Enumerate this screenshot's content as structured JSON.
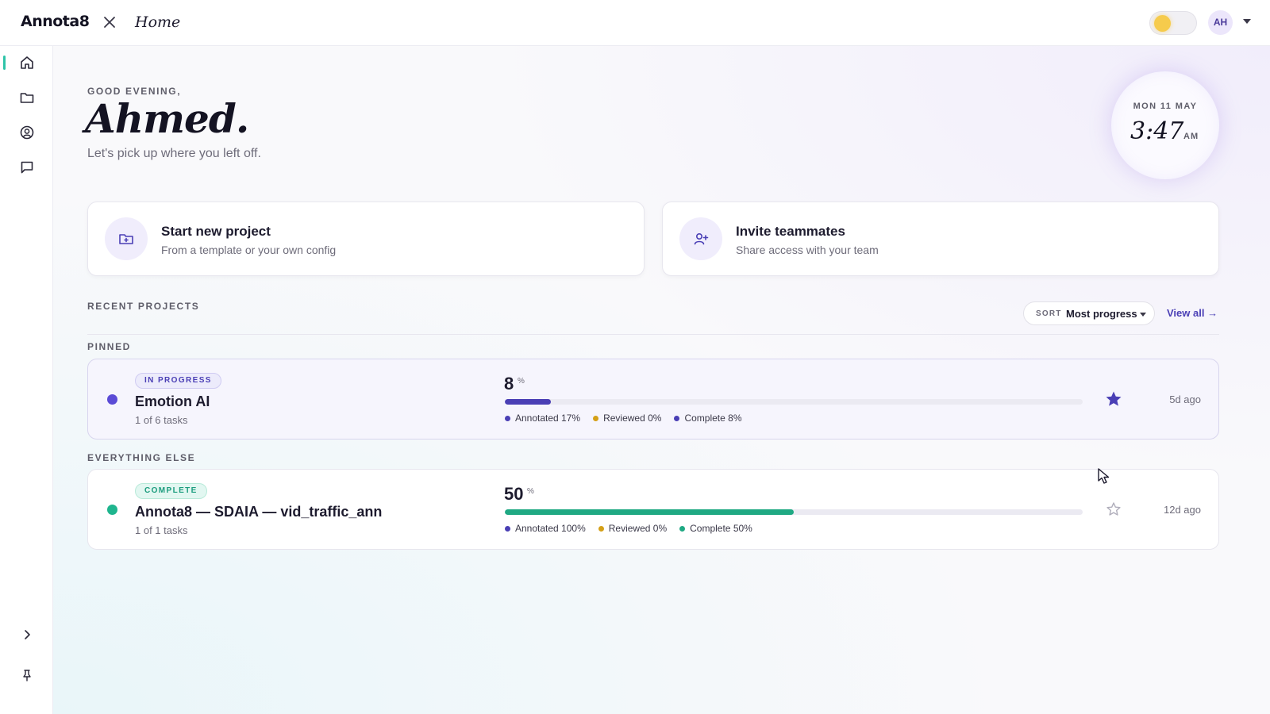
{
  "app": {
    "logo": "Annota8",
    "breadcrumb": "Home"
  },
  "topbar": {
    "close_icon": "close-icon",
    "theme_toggle": {
      "state": "light",
      "knob_color": "#f6cb4c"
    },
    "avatar_initials": "AH",
    "avatar_caret_icon": "chevron-down-icon"
  },
  "sidebar": {
    "items": [
      {
        "name": "home",
        "icon": "home-icon",
        "active": true
      },
      {
        "name": "projects",
        "icon": "folder-icon",
        "active": false
      },
      {
        "name": "account",
        "icon": "user-circle-icon",
        "active": false
      },
      {
        "name": "messages",
        "icon": "message-icon",
        "active": false
      }
    ],
    "expand_icon": "chevron-right-icon",
    "pin_icon": "pin-icon",
    "active_color": "#2ec4a8"
  },
  "greeting": {
    "kicker": "GOOD EVENING,",
    "name": "Ahmed.",
    "subtitle": "Let's pick up where you left off."
  },
  "clock": {
    "date": "MON 11 MAY",
    "time": "3:47",
    "ampm": "AM"
  },
  "actions": [
    {
      "title": "Start new project",
      "subtitle": "From a template or your own config",
      "icon": "folder-plus-icon"
    },
    {
      "title": "Invite teammates",
      "subtitle": "Share access with your team",
      "icon": "user-plus-icon"
    }
  ],
  "recent": {
    "label": "RECENT PROJECTS",
    "sort_key": "SORT",
    "sort_value": "Most progress",
    "view_all": "View all →",
    "pinned_label": "PINNED",
    "everything_else_label": "EVERYTHING ELSE"
  },
  "projects": [
    {
      "status": "IN PROGRESS",
      "status_color": "#5b4bd6",
      "name": "Emotion AI",
      "tasks": "1 of 6 tasks",
      "percent": "8",
      "percent_sign": "%",
      "progress": 0.08,
      "bar_color": "#4a3fb5",
      "legend": [
        {
          "label": "Annotated 17%",
          "color": "#4a3fb5"
        },
        {
          "label": "Reviewed 0%",
          "color": "#d4a017"
        },
        {
          "label": "Complete 8%",
          "color": "#4a3fb5"
        }
      ],
      "starred": true,
      "ago": "5d ago"
    },
    {
      "status": "COMPLETE",
      "status_color": "#1fb58e",
      "name": "Annota8 — SDAIA — vid_traffic_ann",
      "tasks": "1 of 1 tasks",
      "percent": "50",
      "percent_sign": "%",
      "progress": 0.5,
      "bar_color": "#1fa983",
      "legend": [
        {
          "label": "Annotated 100%",
          "color": "#4a3fb5"
        },
        {
          "label": "Reviewed 0%",
          "color": "#d4a017"
        },
        {
          "label": "Complete 50%",
          "color": "#1fa983"
        }
      ],
      "starred": false,
      "ago": "12d ago"
    }
  ],
  "colors": {
    "accent": "#4a3fb5",
    "complete": "#1fa983",
    "reviewed": "#d4a017"
  }
}
